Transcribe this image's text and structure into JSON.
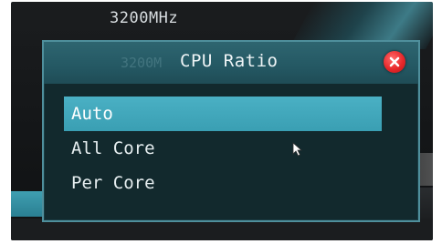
{
  "background": {
    "frequency_text": "3200MHz"
  },
  "dialog": {
    "title": "CPU Ratio",
    "ghost_text": "3200M",
    "options": [
      {
        "label": "Auto",
        "selected": true
      },
      {
        "label": "All Core",
        "selected": false
      },
      {
        "label": "Per Core",
        "selected": false
      }
    ],
    "close_icon": "close-icon"
  },
  "colors": {
    "accent": "#3a9fb3",
    "dialog_bg": "#12292d",
    "header_bg": "#245863",
    "close_red": "#e8282b"
  }
}
